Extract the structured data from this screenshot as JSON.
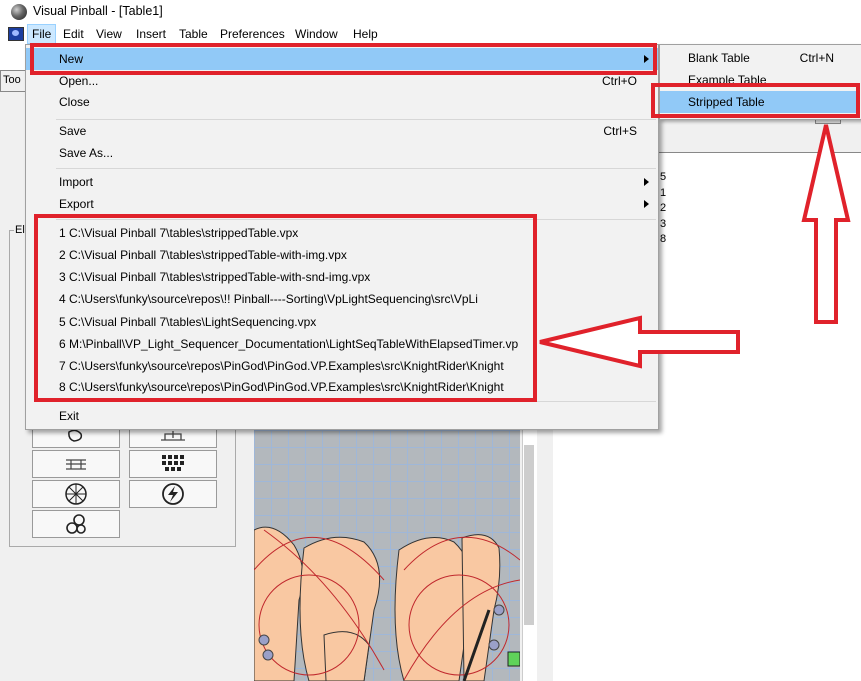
{
  "window": {
    "title": "Visual Pinball - [Table1]"
  },
  "menubar": {
    "items": [
      "File",
      "Edit",
      "View",
      "Insert",
      "Table",
      "Preferences",
      "Window",
      "Help"
    ]
  },
  "file_menu": {
    "new": "New",
    "open": {
      "label": "Open...",
      "shortcut": "Ctrl+O"
    },
    "close": "Close",
    "save": {
      "label": "Save",
      "shortcut": "Ctrl+S"
    },
    "save_as": "Save As...",
    "import": "Import",
    "export": "Export",
    "recent": [
      "1 C:\\Visual Pinball 7\\tables\\strippedTable.vpx",
      "2 C:\\Visual Pinball 7\\tables\\strippedTable-with-img.vpx",
      "3 C:\\Visual Pinball 7\\tables\\strippedTable-with-snd-img.vpx",
      "4 C:\\Users\\funky\\source\\repos\\!! Pinball----Sorting\\VpLightSequencing\\src\\VpLi",
      "5 C:\\Visual Pinball 7\\tables\\LightSequencing.vpx",
      "6 M:\\Pinball\\VP_Light_Sequencer_Documentation\\LightSeqTableWithElapsedTimer.vp",
      "7 C:\\Users\\funky\\source\\repos\\PinGod\\PinGod.VP.Examples\\src\\KnightRider\\Knight",
      "8 C:\\Users\\funky\\source\\repos\\PinGod\\PinGod.VP.Examples\\src\\KnightRider\\Knight"
    ],
    "exit": "Exit"
  },
  "new_submenu": {
    "blank": {
      "label": "Blank Table",
      "shortcut": "Ctrl+N"
    },
    "example": {
      "label": "Example Table"
    },
    "stripped": {
      "label": "Stripped Table"
    }
  },
  "background": {
    "toolbar_label": "Too",
    "elements_label": "El",
    "right_numbers": [
      "5",
      "1",
      "2",
      "3",
      "8"
    ]
  },
  "colors": {
    "highlight": "#91c9f7",
    "annotation": "#e0222b",
    "menu_bg": "#f2f2f2"
  }
}
